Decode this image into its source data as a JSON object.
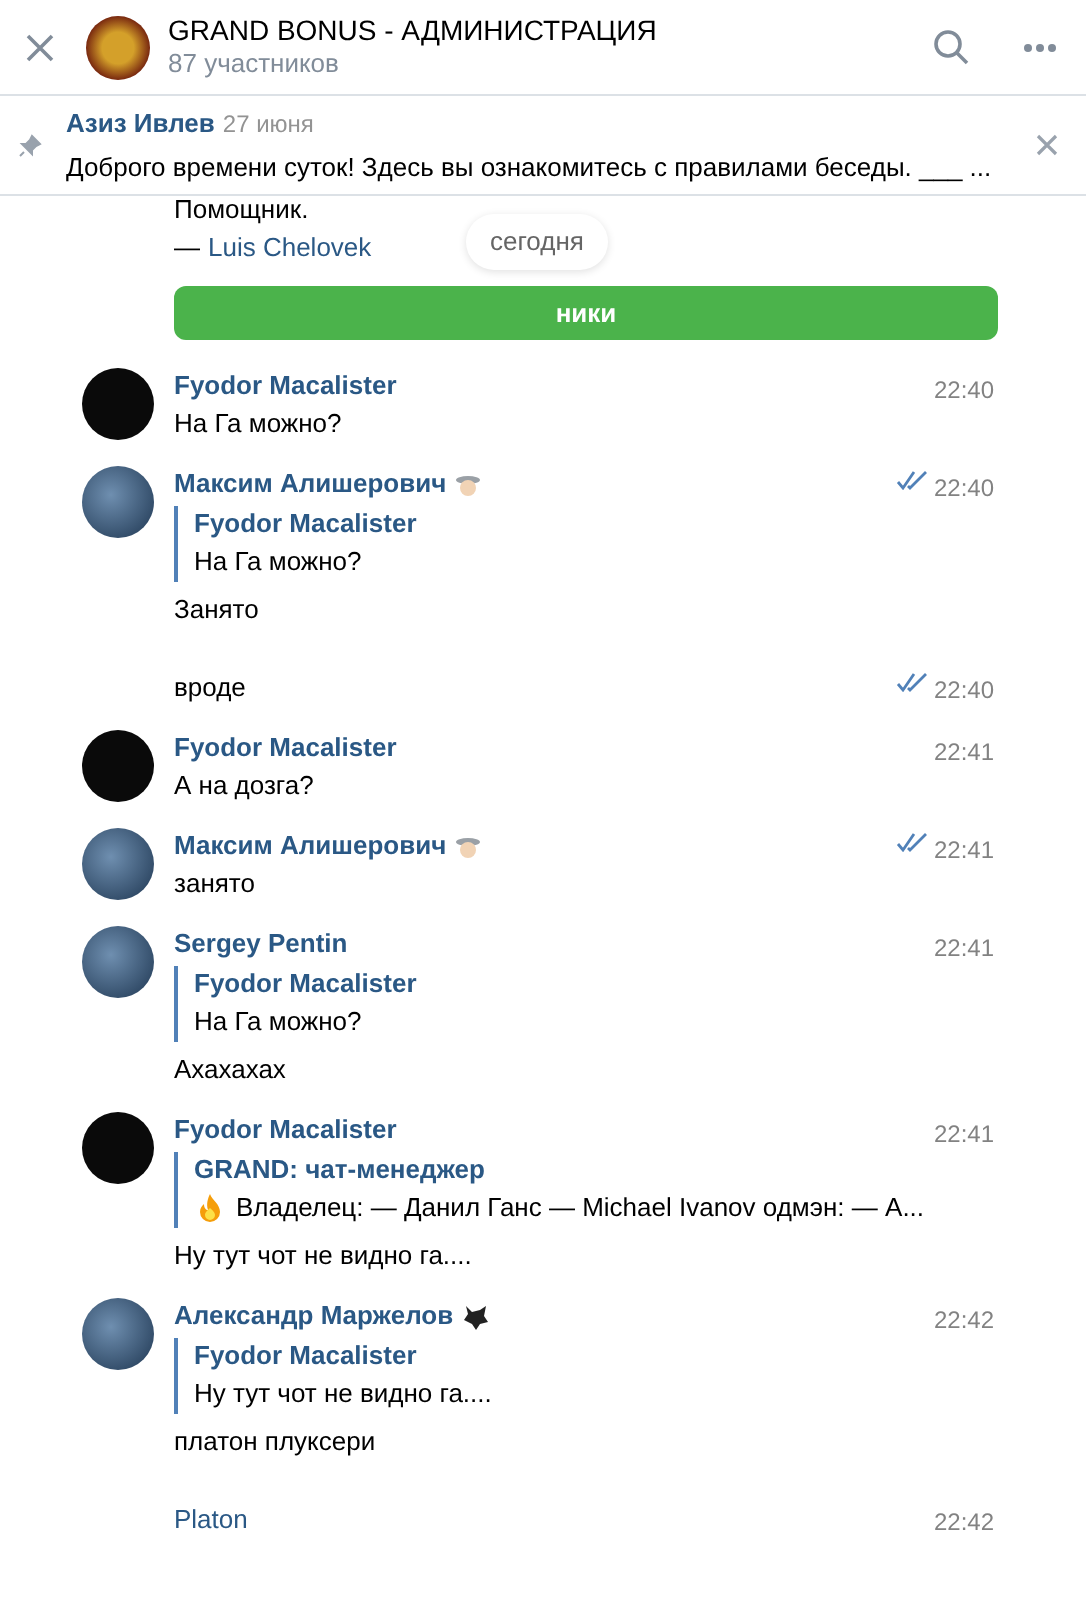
{
  "header": {
    "title": "GRAND BONUS - АДМИНИСТРАЦИЯ",
    "subtitle": "87 участников"
  },
  "pinned": {
    "author": "Азиз Ивлев",
    "date": "27 июня",
    "text": "Доброго времени суток! Здесь вы ознакомитесь с правилами беседы. ___ ..."
  },
  "previous": {
    "lines": [
      "Помощник."
    ],
    "signature_dash": "—",
    "signature": "Luis Chelovek",
    "button": "ники"
  },
  "date_divider": "сегодня",
  "messages": [
    {
      "kind": "first",
      "avatar": {
        "kind": "plain"
      },
      "author": "Fyodor Macalister",
      "time": "22:40",
      "read": false,
      "text": "На Га можно?"
    },
    {
      "kind": "first",
      "avatar": {
        "kind": "photo"
      },
      "author": "Максим Алишерович",
      "badge": {
        "kind": "hat"
      },
      "time": "22:40",
      "read": true,
      "quote": {
        "author": "Fyodor Macalister",
        "text": "На Га можно?"
      },
      "text": "Занято"
    },
    {
      "kind": "continuation",
      "time": "22:40",
      "read": true,
      "text": "вроде",
      "link": false
    },
    {
      "kind": "first",
      "avatar": {
        "kind": "plain"
      },
      "author": "Fyodor Macalister",
      "time": "22:41",
      "read": false,
      "text": "А на дозга?"
    },
    {
      "kind": "first",
      "avatar": {
        "kind": "photo"
      },
      "author": "Максим Алишерович",
      "badge": {
        "kind": "hat"
      },
      "time": "22:41",
      "read": true,
      "text": "занято"
    },
    {
      "kind": "first",
      "avatar": {
        "kind": "photo"
      },
      "author": "Sergey Pentin",
      "time": "22:41",
      "read": false,
      "quote": {
        "author": "Fyodor Macalister",
        "text": "На Га можно?"
      },
      "text": "Ахахахах"
    },
    {
      "kind": "first",
      "avatar": {
        "kind": "plain"
      },
      "author": "Fyodor Macalister",
      "time": "22:41",
      "read": false,
      "quote": {
        "author": "GRAND: чат-менеджер",
        "icon": {
          "kind": "fire"
        },
        "text": "Владелец: — Данил Ганс — Michael Ivanov одмэн: — А..."
      },
      "text": "Ну тут чот не видно га...."
    },
    {
      "kind": "first",
      "avatar": {
        "kind": "photo"
      },
      "author": "Александр Маржелов",
      "badge": {
        "kind": "wolf"
      },
      "time": "22:42",
      "read": false,
      "quote": {
        "author": "Fyodor Macalister",
        "text": "Ну тут чот не видно га...."
      },
      "text": "платон плуксери"
    },
    {
      "kind": "continuation",
      "time": "22:42",
      "read": false,
      "text": "Platon",
      "link": true
    }
  ]
}
